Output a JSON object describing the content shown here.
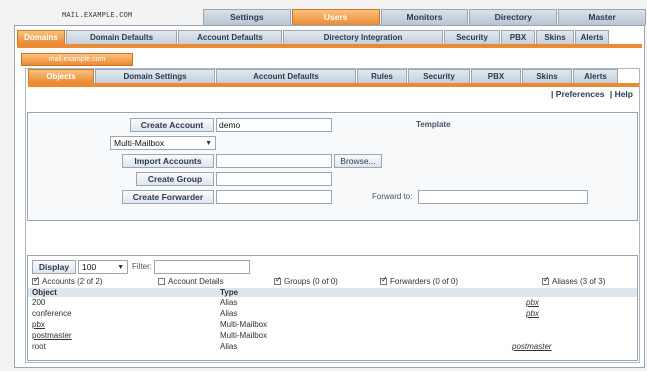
{
  "host": "MAIL.EXAMPLE.COM",
  "top_tabs": [
    {
      "label": "Settings",
      "active": false
    },
    {
      "label": "Users",
      "active": true
    },
    {
      "label": "Monitors",
      "active": false
    },
    {
      "label": "Directory",
      "active": false
    },
    {
      "label": "Master",
      "active": false
    }
  ],
  "domain_tabs": [
    {
      "label": "Domains",
      "active": true
    },
    {
      "label": "Domain Defaults",
      "active": false
    },
    {
      "label": "Account Defaults",
      "active": false
    },
    {
      "label": "Directory Integration",
      "active": false
    },
    {
      "label": "Security",
      "active": false
    },
    {
      "label": "PBX",
      "active": false
    },
    {
      "label": "Skins",
      "active": false
    },
    {
      "label": "Alerts",
      "active": false
    }
  ],
  "selected_domain": "mail.example.com",
  "object_tabs": [
    {
      "label": "Objects",
      "active": true
    },
    {
      "label": "Domain Settings",
      "active": false
    },
    {
      "label": "Account Defaults",
      "active": false
    },
    {
      "label": "Rules",
      "active": false
    },
    {
      "label": "Security",
      "active": false
    },
    {
      "label": "PBX",
      "active": false
    },
    {
      "label": "Skins",
      "active": false
    },
    {
      "label": "Alerts",
      "active": false
    }
  ],
  "links": {
    "preferences": "| Preferences",
    "help": "| Help"
  },
  "form": {
    "create_account": "Create Account",
    "account_name_value": "demo",
    "template_label": "Template",
    "account_type": "Multi-Mailbox",
    "import_accounts": "Import Accounts",
    "browse": "Browse...",
    "create_group": "Create Group",
    "create_forwarder": "Create Forwarder",
    "forward_to_label": "Forward to:"
  },
  "list": {
    "display_button": "Display",
    "page_size": "100",
    "filter_label": "Filter:",
    "filter_value": "",
    "checkboxes": [
      {
        "label": "Accounts (2 of 2)",
        "checked": true
      },
      {
        "label": "Account Details",
        "checked": false
      },
      {
        "label": "Groups (0 of 0)",
        "checked": true
      },
      {
        "label": "Forwarders (0 of 0)",
        "checked": true
      },
      {
        "label": "Aliases (3 of 3)",
        "checked": true
      }
    ],
    "columns": {
      "object": "Object",
      "type": "Type"
    },
    "rows": [
      {
        "object": "200",
        "type": "Alias",
        "target": "pbx"
      },
      {
        "object": "conference",
        "type": "Alias",
        "target": "pbx"
      },
      {
        "object": "pbx",
        "type": "Multi-Mailbox",
        "target": ""
      },
      {
        "object": "postmaster",
        "type": "Multi-Mailbox",
        "target": ""
      },
      {
        "object": "root",
        "type": "Alias",
        "target": "postmaster"
      }
    ]
  },
  "colors": {
    "accent": "#ec8a32",
    "tab": "#c5cfda",
    "text": "#2b3a55"
  }
}
